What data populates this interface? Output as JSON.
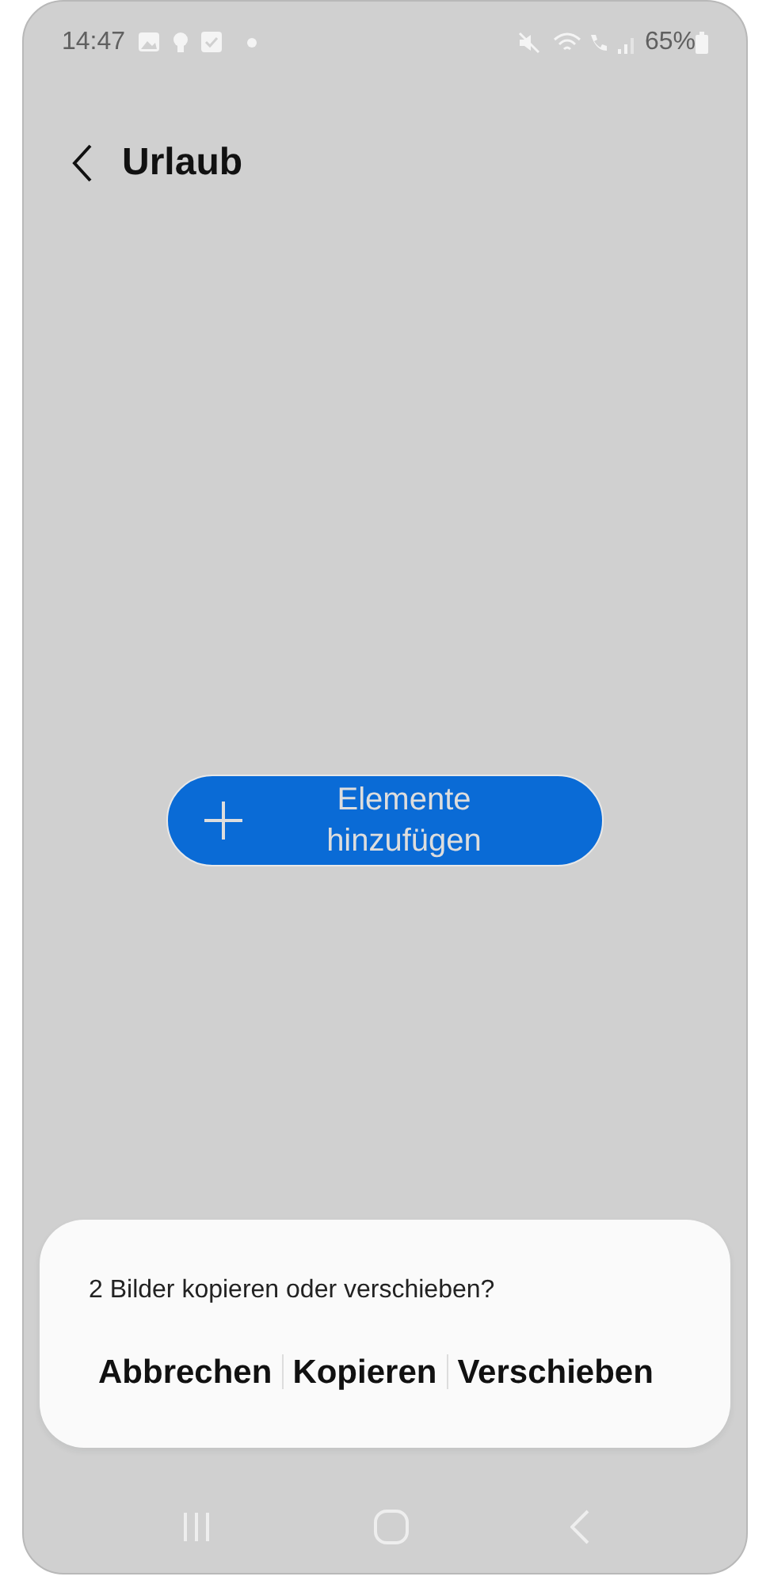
{
  "status_bar": {
    "time": "14:47",
    "battery": "65%"
  },
  "header": {
    "title": "Urlaub"
  },
  "add_button": {
    "label_lines": [
      "Elemente",
      "hinzufügen"
    ]
  },
  "dialog": {
    "message": "2 Bilder kopieren oder verschieben?",
    "buttons": [
      "Abbrechen",
      "Kopieren",
      "Verschieben"
    ]
  }
}
